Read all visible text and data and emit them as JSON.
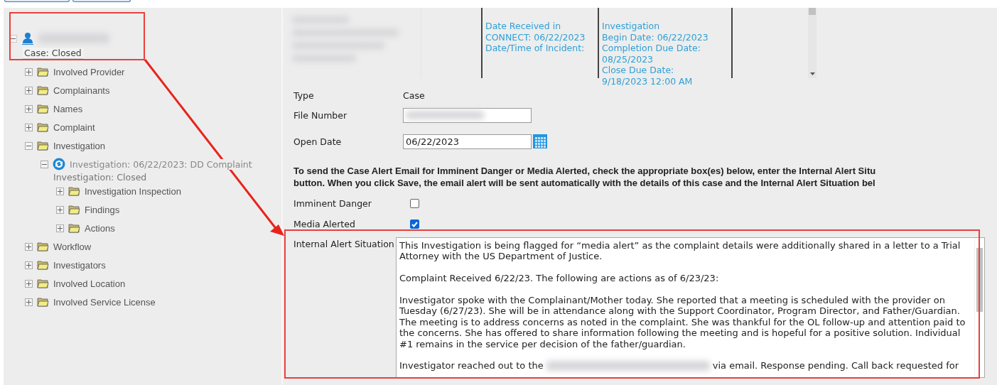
{
  "tree": {
    "status": "Case: Closed",
    "expanded": true,
    "children": [
      {
        "kind": "folder",
        "label": "Involved Provider",
        "expanded": false
      },
      {
        "kind": "folder",
        "label": "Complainants",
        "expanded": false
      },
      {
        "kind": "folder",
        "label": "Names",
        "expanded": false
      },
      {
        "kind": "folder",
        "label": "Complaint",
        "expanded": false
      },
      {
        "kind": "folder",
        "label": "Investigation",
        "expanded": true,
        "children": [
          {
            "kind": "record",
            "label": "Investigation: 06/22/2023: DD Complaint",
            "status": "Investigation: Closed",
            "expanded": true,
            "children": [
              {
                "kind": "folder",
                "label": "Investigation Inspection",
                "expanded": false
              },
              {
                "kind": "folder",
                "label": "Findings",
                "expanded": false
              },
              {
                "kind": "folder",
                "label": "Actions",
                "expanded": false
              }
            ]
          }
        ]
      },
      {
        "kind": "folder",
        "label": "Workflow",
        "expanded": false
      },
      {
        "kind": "folder",
        "label": "Investigators",
        "expanded": false
      },
      {
        "kind": "folder",
        "label": "Involved Location",
        "expanded": false
      },
      {
        "kind": "folder",
        "label": "Involved Service License",
        "expanded": false
      }
    ]
  },
  "summary": {
    "columns": [
      {
        "lines": [
          "Date Received in",
          "CONNECT: 06/22/2023",
          "Date/Time of Incident:"
        ]
      },
      {
        "lines": [
          "Investigation",
          "Begin Date: 06/22/2023",
          "Completion Due Date:",
          "08/25/2023",
          "Close Due Date:",
          "9/18/2023 12:00 AM"
        ]
      }
    ]
  },
  "form": {
    "fields": [
      {
        "kind": "text",
        "label": "Type",
        "value": "Case"
      },
      {
        "kind": "redacted-input",
        "label": "File Number"
      },
      {
        "kind": "date",
        "label": "Open Date",
        "value": "06/22/2023"
      }
    ],
    "notice": [
      "To send the Case Alert Email for Imminent Danger or Media Alerted, check the appropriate box(es) below, enter the Internal Alert Situ",
      "button. When you click Save, the email alert will be sent automatically with the details of this case and the Internal Alert Situation bel"
    ],
    "checks": [
      {
        "label": "Imminent Danger",
        "checked": false
      },
      {
        "label": "Media Alerted",
        "checked": true
      }
    ],
    "alert": {
      "label": "Internal Alert Situation",
      "paragraphs": [
        {
          "kind": "text",
          "text": "This Investigation is being flagged for “media alert” as the complaint details were additionally shared in a letter to a Trial Attorney with the US Department of Justice."
        },
        {
          "kind": "text",
          "text": "Complaint Received 6/22/23. The following are actions as of 6/23/23:"
        },
        {
          "kind": "text",
          "text": "Investigator spoke with the Complainant/Mother today. She reported that a meeting is scheduled with the provider on Tuesday (6/27/23). She will be in attendance along with the Support Coordinator, Program Director, and Father/Guardian. The meeting is to address concerns as noted in the complaint. She was thankful for the OL follow-up and attention paid to the concerns. She has offered to share information following the meeting and is hopeful for a positive solution. Individual #1 remains in the service per decision of the father/guardian."
        },
        {
          "kind": "redacted",
          "before": "Investigator reached out to the",
          "after": "via email. Response pending. Call back requested for"
        }
      ]
    }
  }
}
